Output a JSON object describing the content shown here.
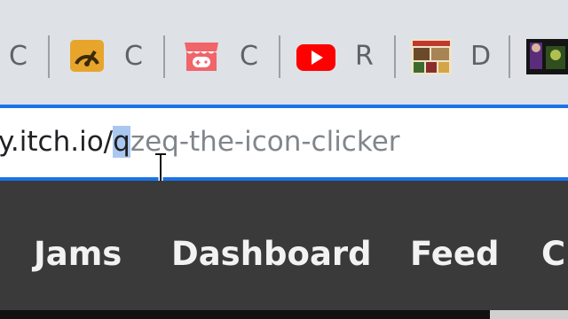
{
  "bookmarks": [
    {
      "icon": "web-icon",
      "label": "C"
    },
    {
      "icon": "speedometer-icon",
      "label": "C"
    },
    {
      "icon": "store-icon",
      "label": "C"
    },
    {
      "icon": "youtube-icon",
      "label": "R"
    },
    {
      "icon": "thumbnail-icon",
      "label": "D"
    },
    {
      "icon": "photo-icon",
      "label": ""
    }
  ],
  "address_bar": {
    "host_text": "y.itch.io/",
    "selected_text": "q",
    "path_text": "zeq-the-icon-clicker"
  },
  "site_nav": {
    "items": [
      "Jams",
      "Dashboard",
      "Feed",
      "C"
    ]
  },
  "colors": {
    "tab_strip_bg": "#dee1e6",
    "focus_ring": "#1a73e8",
    "selection": "#aac7ef",
    "nav_bg": "#3a3a3a",
    "nav_text": "#f2f2f2"
  }
}
